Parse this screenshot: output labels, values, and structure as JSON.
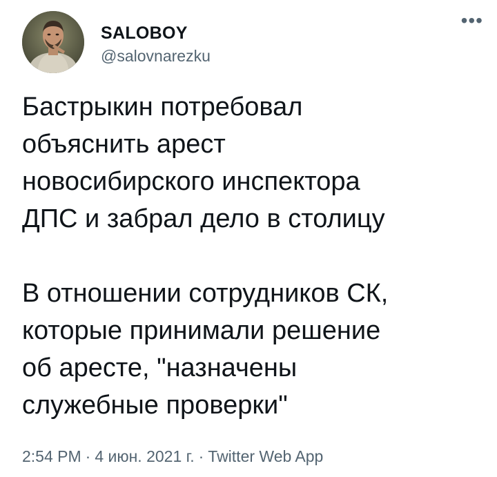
{
  "tweet": {
    "author": {
      "display_name": "SALOBOY",
      "handle": "@salovnarezku",
      "avatar_icon": "user-avatar"
    },
    "more_icon": "more-horizontal-icon",
    "more_glyph": "•••",
    "paragraphs": [
      {
        "lines": [
          "Бастрыкин потребовал",
          "объяснить арест",
          "новосибирского инспектора",
          "ДПС и забрал дело в столицу"
        ]
      },
      {
        "lines": [
          "В отношении сотрудников СК,",
          "которые принимали решение",
          "об аресте, \"назначены",
          "служебные проверки\""
        ]
      }
    ],
    "meta": {
      "time": "2:54 PM",
      "separator": "·",
      "date": "4 июн. 2021 г.",
      "source": "Twitter Web App"
    }
  }
}
